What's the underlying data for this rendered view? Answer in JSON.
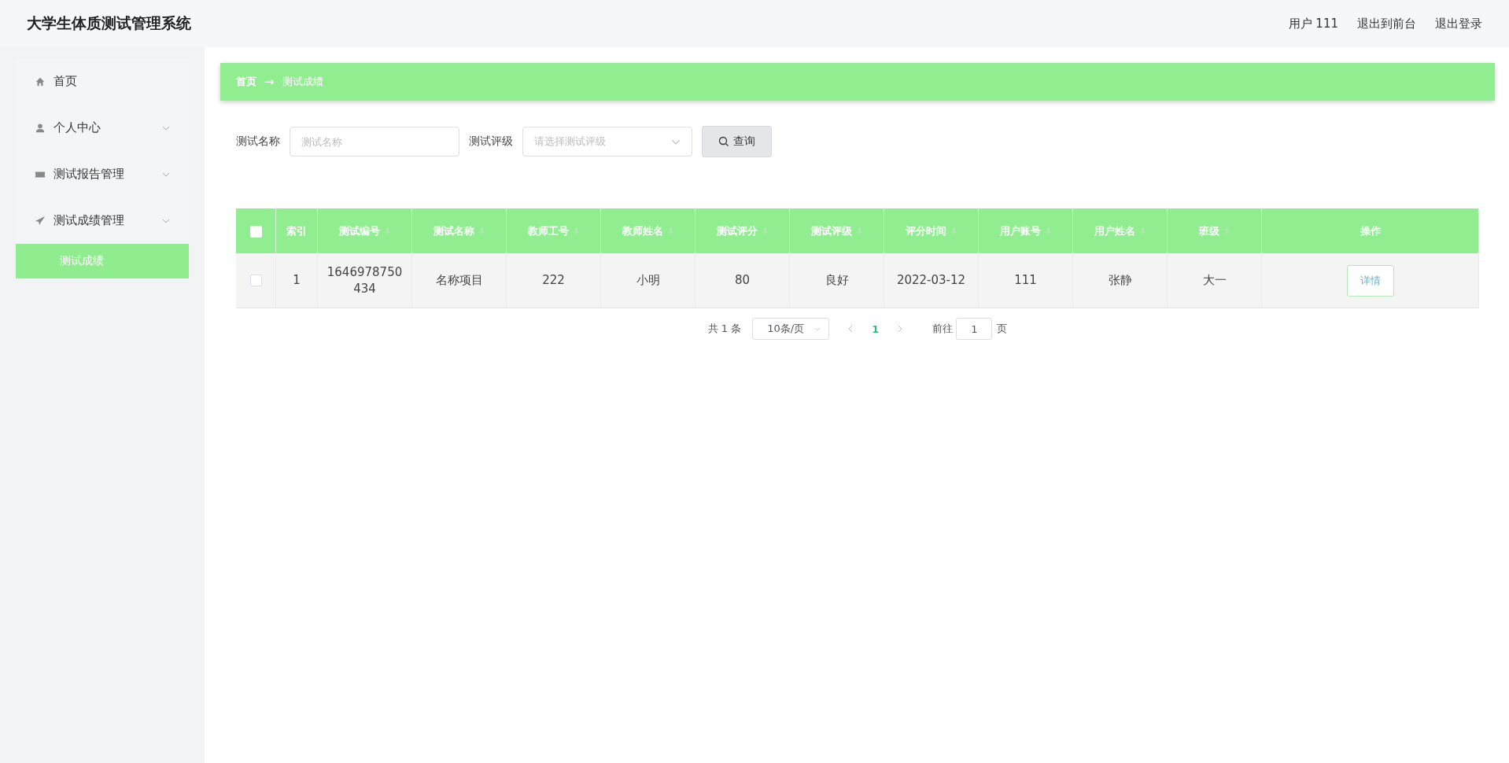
{
  "header": {
    "title": "大学生体质测试管理系统",
    "links": [
      "用户 111",
      "退出到前台",
      "退出登录"
    ]
  },
  "sidebar": {
    "items": [
      {
        "label": "首页"
      },
      {
        "label": "个人中心"
      },
      {
        "label": "测试报告管理"
      },
      {
        "label": "测试成绩管理",
        "children": [
          {
            "label": "测试成绩",
            "selected": true
          }
        ]
      }
    ]
  },
  "breadcrumb": {
    "items": [
      "首页",
      "测试成绩"
    ],
    "separator": "→"
  },
  "search": {
    "fields": [
      {
        "kind": "input",
        "label": "测试名称",
        "placeholder": "测试名称"
      },
      {
        "kind": "select",
        "label": "测试评级",
        "placeholder": "请选择测试评级"
      }
    ],
    "button": "查询"
  },
  "table": {
    "header_checked": false,
    "columns": [
      {
        "label": "索引",
        "sortable": false
      },
      {
        "label": "测试编号",
        "sortable": true
      },
      {
        "label": "测试名称",
        "sortable": true
      },
      {
        "label": "教师工号",
        "sortable": true
      },
      {
        "label": "教师姓名",
        "sortable": true
      },
      {
        "label": "测试评分",
        "sortable": true
      },
      {
        "label": "测试评级",
        "sortable": true
      },
      {
        "label": "评分时间",
        "sortable": true
      },
      {
        "label": "用户账号",
        "sortable": true
      },
      {
        "label": "用户姓名",
        "sortable": true
      },
      {
        "label": "班级",
        "sortable": true
      },
      {
        "label": "操作",
        "sortable": false
      }
    ],
    "rows": [
      {
        "checked": false,
        "cells": [
          "1",
          "1646978750434",
          "名称项目",
          "222",
          "小明",
          "80",
          "良好",
          "2022-03-12",
          "111",
          "张静",
          "大一"
        ],
        "action": "详情"
      }
    ]
  },
  "pagination": {
    "total": "共 1 条",
    "page_size": "10条/页",
    "pages": [
      {
        "label": "1",
        "selected": true
      }
    ],
    "goto_label": "前往",
    "goto_value": "1",
    "page_suffix": "页"
  }
}
